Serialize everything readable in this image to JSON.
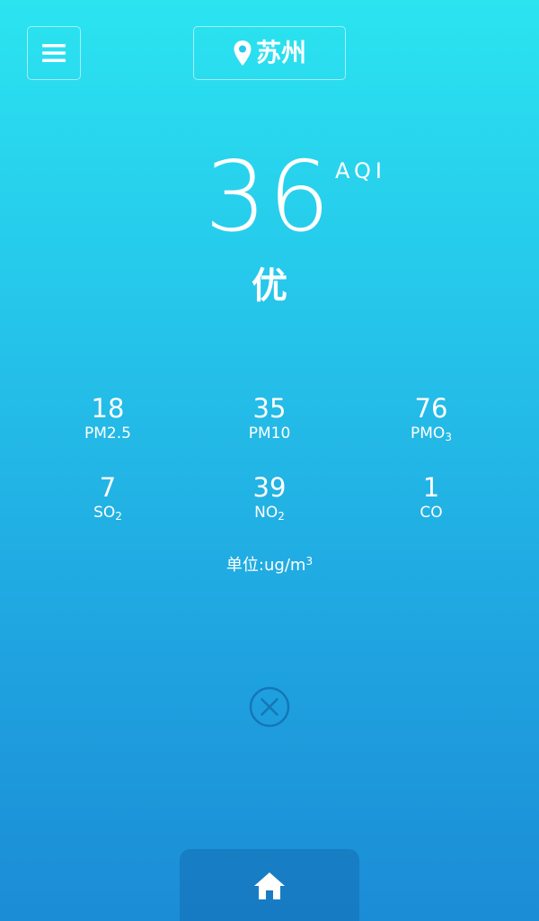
{
  "header": {
    "menu_icon": "hamburger-menu-icon",
    "location_icon": "map-pin-icon",
    "city": "苏州"
  },
  "aqi": {
    "value": "36",
    "unit": "AQI",
    "level": "优"
  },
  "pollutants": [
    {
      "value": "18",
      "name": "PM2.5",
      "sub": ""
    },
    {
      "value": "35",
      "name": "PM10",
      "sub": ""
    },
    {
      "value": "76",
      "name": "PMO",
      "sub": "3"
    },
    {
      "value": "7",
      "name": "SO",
      "sub": "2"
    },
    {
      "value": "39",
      "name": "NO",
      "sub": "2"
    },
    {
      "value": "1",
      "name": "CO",
      "sub": ""
    }
  ],
  "unit_note": {
    "prefix": "单位:",
    "unit": "ug/m",
    "sup": "3"
  },
  "close_icon": "close-circle-icon",
  "bottom_nav": {
    "home_icon": "home-icon"
  },
  "colors": {
    "gradient_top": "#2be4f0",
    "gradient_bottom": "#1b8cd6",
    "text": "#ffffff"
  }
}
